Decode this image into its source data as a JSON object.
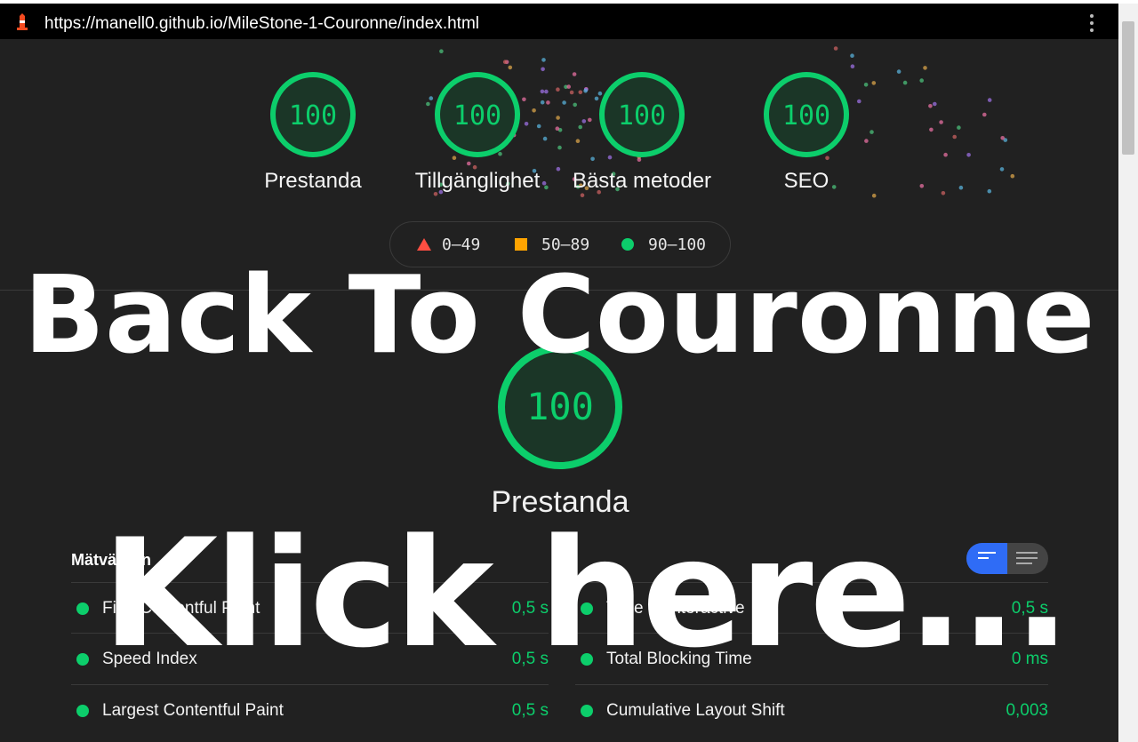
{
  "browser": {
    "url": "https://manell0.github.io/MileStone-1-Couronne/index.html",
    "favicon": "lighthouse-icon",
    "menu_icon": "kebab-menu-icon"
  },
  "scores": [
    {
      "value": "100",
      "label": "Prestanda"
    },
    {
      "value": "100",
      "label": "Tillgänglighet"
    },
    {
      "value": "100",
      "label": "Bästa metoder"
    },
    {
      "value": "100",
      "label": "SEO"
    }
  ],
  "legend": [
    {
      "range": "0–49",
      "shape": "triangle",
      "color": "#ff4e42"
    },
    {
      "range": "50–89",
      "shape": "square",
      "color": "#ffa400"
    },
    {
      "range": "90–100",
      "shape": "circle",
      "color": "#0cce6b"
    }
  ],
  "performance": {
    "score": "100",
    "label": "Prestanda"
  },
  "metrics_title": "Mätvärden",
  "metrics_left": [
    {
      "name": "First Contentful Paint",
      "value": "0,5 s"
    },
    {
      "name": "Speed Index",
      "value": "0,5 s"
    },
    {
      "name": "Largest Contentful Paint",
      "value": "0,5 s"
    }
  ],
  "metrics_right": [
    {
      "name": "Time to Interactive",
      "value": "0,5 s"
    },
    {
      "name": "Total Blocking Time",
      "value": "0 ms"
    },
    {
      "name": "Cumulative Layout Shift",
      "value": "0,003"
    }
  ],
  "overlay": {
    "line1": "Back To Couronne",
    "line2": "Klick here..."
  },
  "colors": {
    "pass": "#0cce6b",
    "background": "#212121",
    "toggle_active": "#2f6cf6"
  }
}
